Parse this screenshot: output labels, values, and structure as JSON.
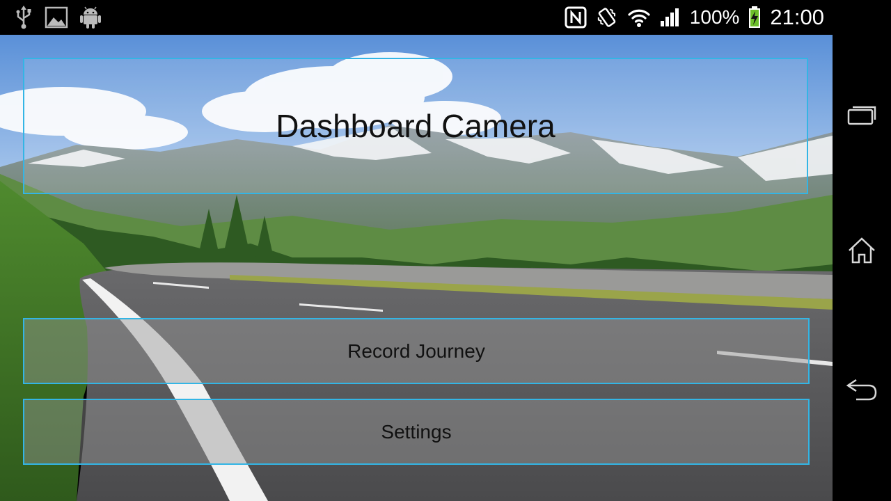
{
  "status_bar": {
    "left_icons": [
      "usb-icon",
      "image-icon",
      "android-icon"
    ],
    "right_icons": [
      "nfc-icon",
      "vibrate-icon",
      "wifi-icon",
      "signal-icon"
    ],
    "battery_percent": "100%",
    "battery_level": 1.0,
    "time": "21:00"
  },
  "app": {
    "title": "Dashboard Camera",
    "buttons": [
      {
        "label": "Record Journey"
      },
      {
        "label": "Settings"
      }
    ],
    "accent_color": "#33b5e5"
  },
  "nav_bar": {
    "icons": [
      "recent-apps-icon",
      "home-icon",
      "back-icon"
    ]
  }
}
